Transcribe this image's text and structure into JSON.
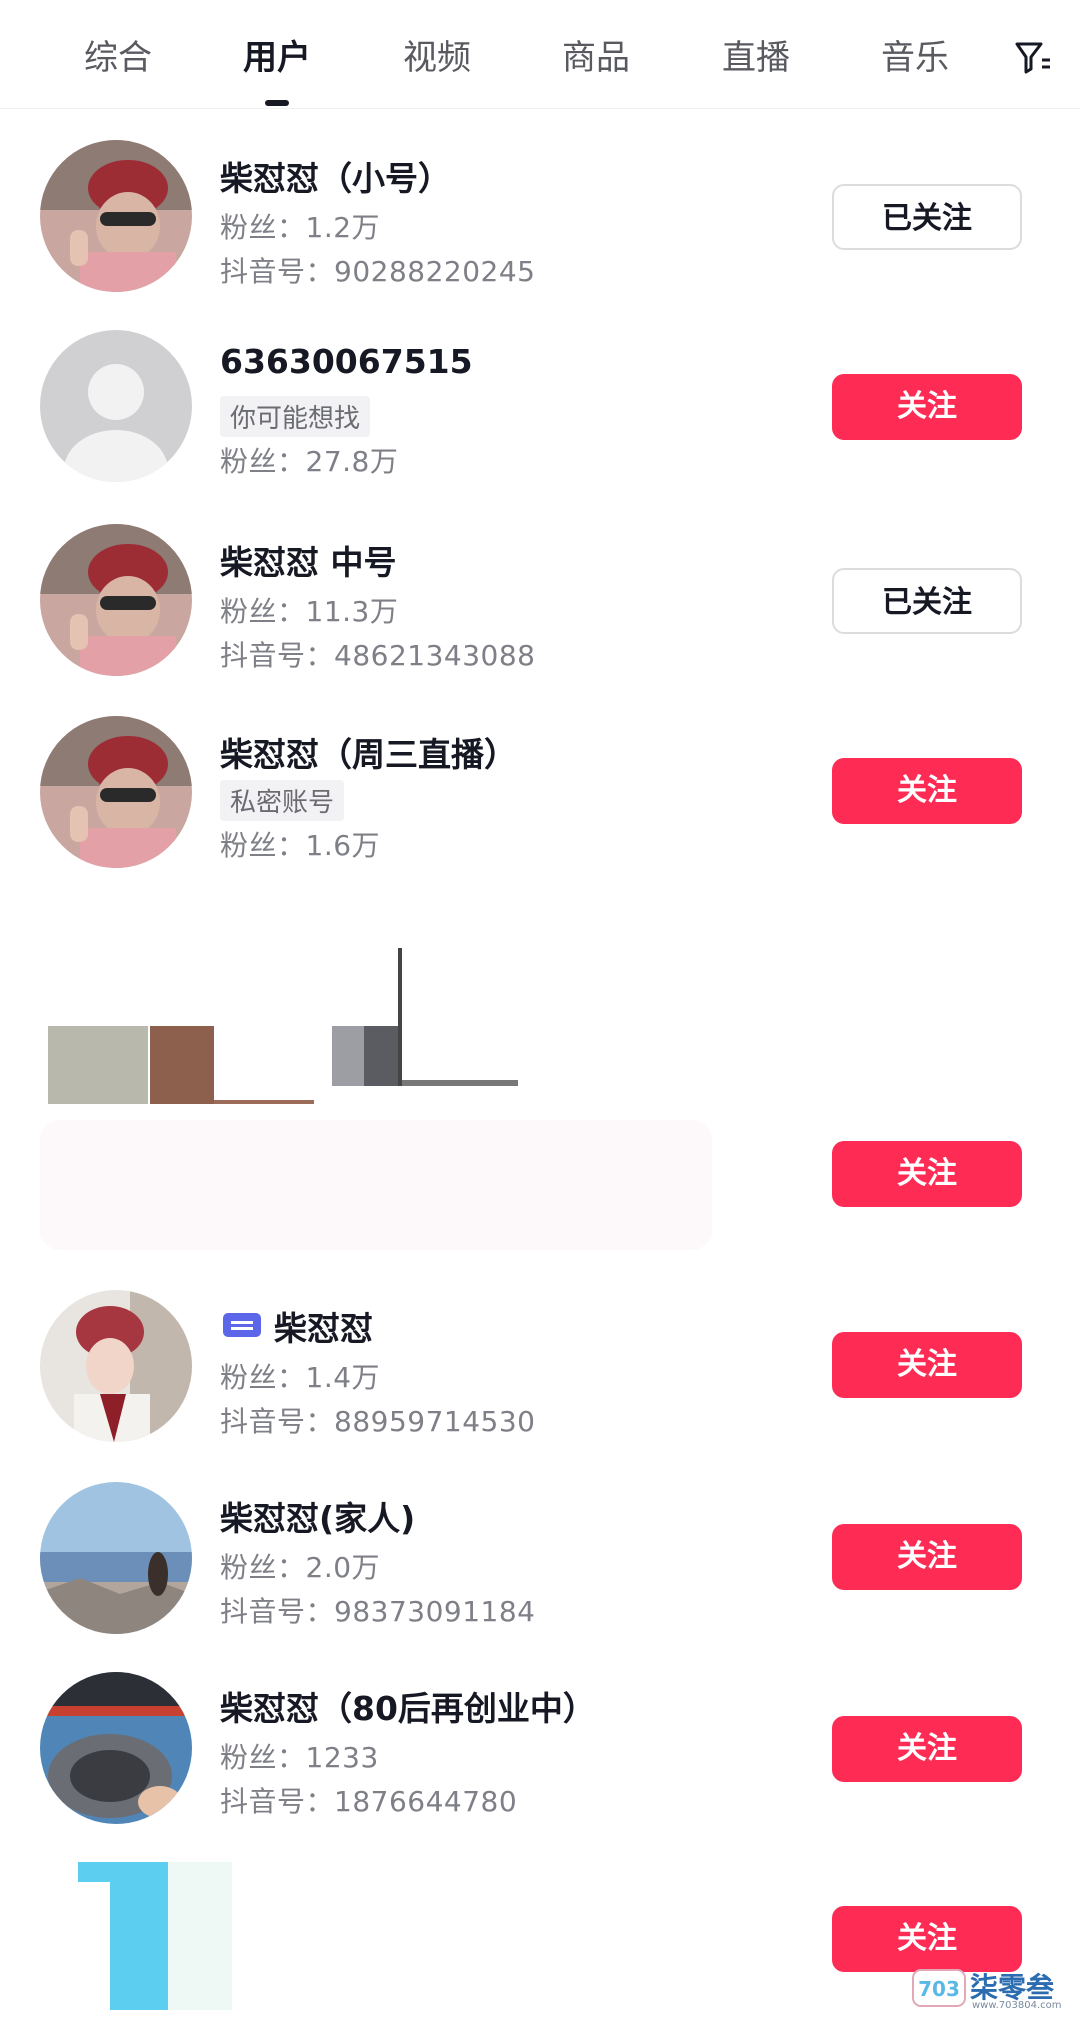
{
  "tabs": [
    {
      "label": "综合"
    },
    {
      "label": "用户",
      "active": true
    },
    {
      "label": "视频"
    },
    {
      "label": "商品"
    },
    {
      "label": "直播"
    },
    {
      "label": "音乐"
    }
  ],
  "results": [
    {
      "name": "柴怼怼（小号）",
      "line1": "粉丝：1.2万",
      "line2": "抖音号：90288220245",
      "button": "已关注"
    },
    {
      "name": "63630067515",
      "tag": "你可能想找",
      "line2": "粉丝：27.8万",
      "button": "关注"
    },
    {
      "name": "柴怼怼 中号",
      "line1": "粉丝：11.3万",
      "line2": "抖音号：48621343088",
      "button": "已关注"
    },
    {
      "name": "柴怼怼（周三直播）",
      "tag": "私密账号",
      "line2": "粉丝：1.6万",
      "button": "关注"
    },
    {
      "button": "关注"
    },
    {
      "name": "柴怼怼",
      "line1": "粉丝：1.4万",
      "line2": "抖音号：88959714530",
      "button": "关注"
    },
    {
      "name": "柴怼怼(家人)",
      "line1": "粉丝：2.0万",
      "line2": "抖音号：98373091184",
      "button": "关注"
    },
    {
      "name": "柴怼怼（80后再创业中）",
      "line1": "粉丝：1233",
      "line2": "抖音号：1876644780",
      "button": "关注"
    },
    {
      "button": "关注"
    }
  ],
  "watermark": {
    "text": "柒零叁",
    "sub": "www.703804.com"
  },
  "colors": {
    "follow": "#fe2c55",
    "text": "#161823",
    "secondary": "#7f8087"
  },
  "icons": [
    "filter-icon",
    "badge-icon",
    "default-avatar-icon"
  ]
}
